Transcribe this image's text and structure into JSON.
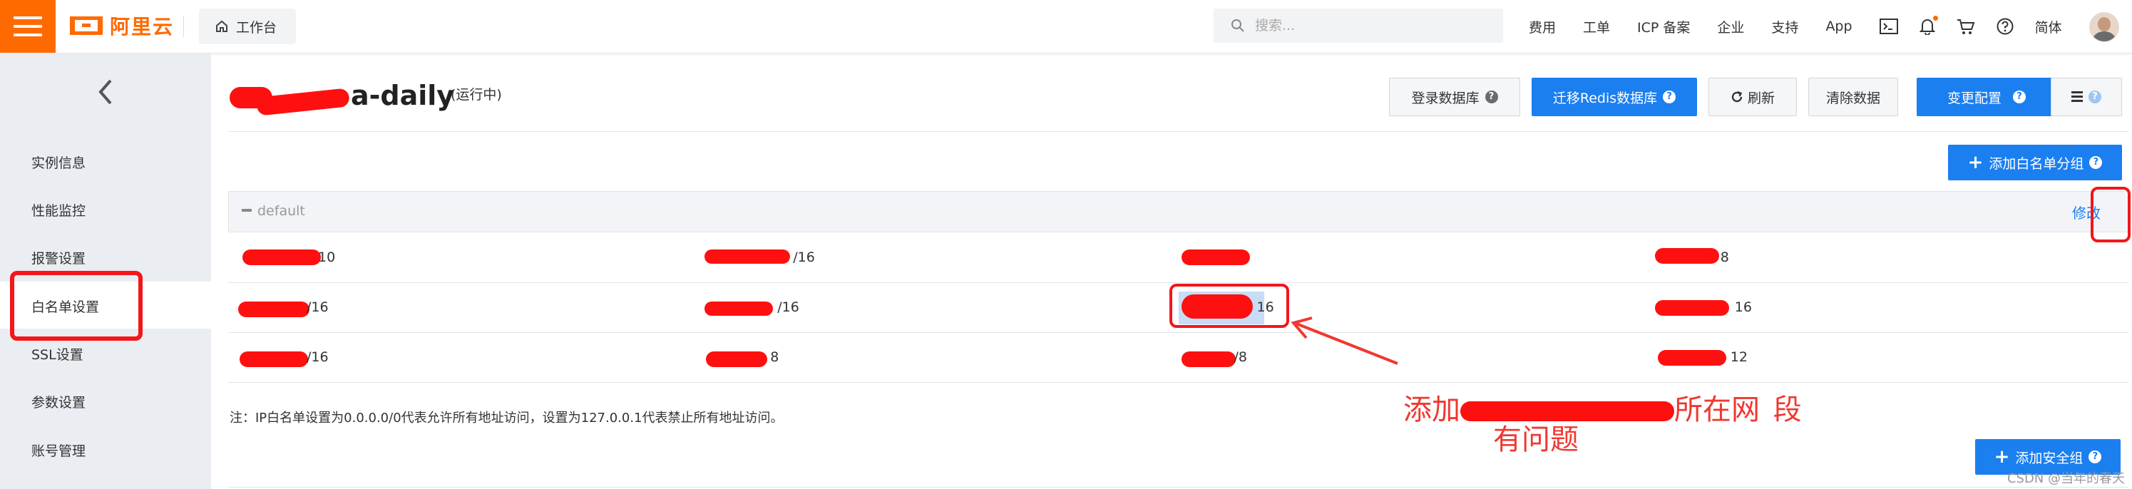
{
  "topbar": {
    "logo_text": "阿里云",
    "workbench_label": "工作台",
    "search_placeholder": "搜索...",
    "nav_items": [
      "费用",
      "工单",
      "ICP 备案",
      "企业",
      "支持",
      "App"
    ],
    "lang_label": "简体",
    "icons": [
      "terminal-icon",
      "bell-icon",
      "cart-icon",
      "help-icon"
    ]
  },
  "sidebar": {
    "items": [
      {
        "label": "实例信息"
      },
      {
        "label": "性能监控"
      },
      {
        "label": "报警设置"
      },
      {
        "label": "白名单设置"
      },
      {
        "label": "SSL设置"
      },
      {
        "label": "参数设置"
      },
      {
        "label": "账号管理"
      }
    ]
  },
  "instance": {
    "title_suffix": "a-daily",
    "status": "(运行中)"
  },
  "toolbar": {
    "login_db": "登录数据库",
    "migrate_redis": "迁移Redis数据库",
    "refresh": "刷新",
    "clear_data": "清除数据",
    "change_config": "变更配置"
  },
  "whitelist": {
    "add_group_label": "添加白名单分组",
    "group_name": "default",
    "edit_label": "修改",
    "rows": [
      [
        "10",
        "/16",
        "",
        "8"
      ],
      [
        "/16",
        "/16",
        "16",
        "16"
      ],
      [
        "/16",
        "8",
        "/8",
        "12"
      ]
    ],
    "note": "注：IP白名单设置为0.0.0.0/0代表允许所有地址访问，设置为127.0.0.1代表禁止所有地址访问。",
    "add_security_group_label": "添加安全组"
  },
  "annotation": {
    "line1_prefix": "添加",
    "line1_suffix": "所在网",
    "line1_end": "段",
    "line2": "有问题"
  },
  "watermark": "CSDN @当年的春天",
  "colors": {
    "brand": "#ff6a00",
    "primary": "#1b7ff0",
    "annotation_red": "#f3161a"
  }
}
